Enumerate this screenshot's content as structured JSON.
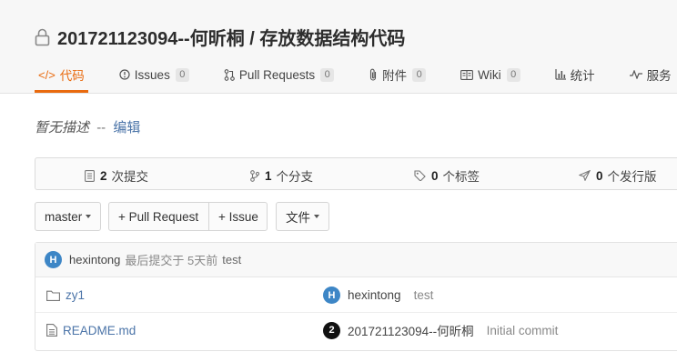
{
  "repo": {
    "title": "201721123094--何昕桐 / 存放数据结构代码"
  },
  "tabs": [
    {
      "label": "代码",
      "icon": "code-icon",
      "badge": null
    },
    {
      "label": "Issues",
      "icon": "issue-icon",
      "badge": "0"
    },
    {
      "label": "Pull Requests",
      "icon": "pull-request-icon",
      "badge": "0"
    },
    {
      "label": "附件",
      "icon": "attachment-icon",
      "badge": "0"
    },
    {
      "label": "Wiki",
      "icon": "wiki-icon",
      "badge": "0"
    },
    {
      "label": "统计",
      "icon": "chart-icon",
      "badge": null
    },
    {
      "label": "服务",
      "icon": "pulse-icon",
      "badge": null
    }
  ],
  "description": {
    "empty_text": "暂无描述",
    "separator": "--",
    "edit_label": "编辑"
  },
  "stats": {
    "commits": {
      "count": "2",
      "label": "次提交"
    },
    "branches": {
      "count": "1",
      "label": "个分支"
    },
    "tags": {
      "count": "0",
      "label": "个标签"
    },
    "releases": {
      "count": "0",
      "label": "个发行版"
    }
  },
  "toolbar": {
    "branch": "master",
    "pull_request": "+ Pull Request",
    "issue": "+ Issue",
    "files": "文件"
  },
  "last_commit": {
    "avatar": "H",
    "author": "hexintong",
    "meta": "最后提交于 5天前",
    "message": "test"
  },
  "files": [
    {
      "name": "zy1",
      "type": "folder",
      "avatar": "H",
      "committer": "hexintong",
      "message": "test"
    },
    {
      "name": "README.md",
      "type": "file",
      "avatar": "2",
      "committer": "201721123094--何昕桐",
      "message": "Initial commit"
    }
  ],
  "colors": {
    "accent": "#e96a0e",
    "link": "#4b74a8",
    "avatar_blue": "#3d86c6"
  }
}
